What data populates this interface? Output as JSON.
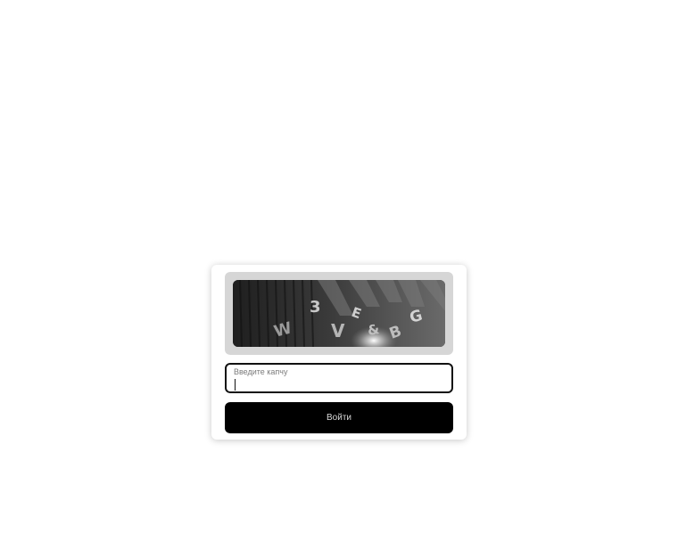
{
  "captcha": {
    "image_alt": "3 W V E & B G",
    "glyphs": [
      "W",
      "3",
      "V",
      "E",
      "&",
      "B",
      "G"
    ],
    "input_label": "Введите капчу",
    "input_value": "",
    "submit_label": "Войти"
  },
  "colors": {
    "button_bg": "#000000",
    "input_border": "#111111",
    "frame_bg": "#d6d6d6"
  }
}
